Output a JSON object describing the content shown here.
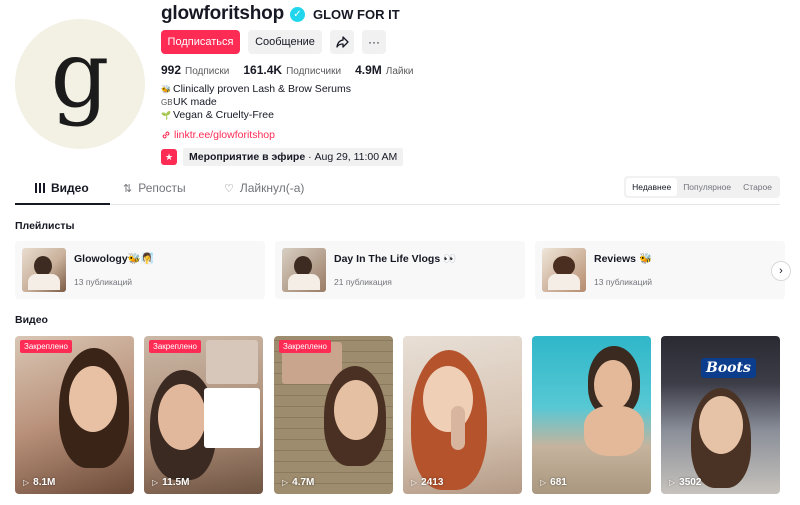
{
  "profile": {
    "avatar_letter": "g",
    "username": "glowforitshop",
    "verified_glyph": "✓",
    "nickname": "GLOW FOR IT",
    "follow_label": "Подписаться",
    "message_label": "Сообщение",
    "share_icon": "share-icon",
    "more_label": "···",
    "stats": [
      {
        "value": "992",
        "label": "Подписки"
      },
      {
        "value": "161.4K",
        "label": "Подписчики"
      },
      {
        "value": "4.9M",
        "label": "Лайки"
      }
    ],
    "bio": [
      {
        "emoji": "🐝",
        "text": "Clinically proven Lash & Brow Serums"
      },
      {
        "emoji": "GB",
        "text": "UK made"
      },
      {
        "emoji": "🌱",
        "text": "Vegan & Cruelty-Free"
      }
    ],
    "link": "linktr.ee/glowforitshop",
    "event": {
      "title": "Мероприятие в эфире",
      "date": " · Aug 29, 11:00 AM"
    }
  },
  "tabs": [
    {
      "label": "Видео",
      "icon": "grid-icon"
    },
    {
      "label": "Репосты",
      "icon": "repost-icon"
    },
    {
      "label": "Лайкнул(-а)",
      "icon": "heart-icon"
    }
  ],
  "sort": [
    "Недавнее",
    "Популярное",
    "Старое"
  ],
  "playlists": {
    "title": "Плейлисты",
    "items": [
      {
        "name": "Glowology🐝🧖‍♀️",
        "count": "13 публикаций"
      },
      {
        "name": "Day In The Life Vlogs 👀",
        "count": "21 публикация"
      },
      {
        "name": "Reviews 🐝",
        "count": "13 публикаций"
      }
    ],
    "next_label": "›"
  },
  "videos": {
    "title": "Видео",
    "items": [
      {
        "views": "8.1M",
        "pinned": "Закреплено"
      },
      {
        "views": "11.5M",
        "pinned": "Закреплено"
      },
      {
        "views": "4.7M",
        "pinned": "Закреплено"
      },
      {
        "views": "2413",
        "pinned": ""
      },
      {
        "views": "681",
        "pinned": ""
      },
      {
        "views": "3502",
        "pinned": "",
        "sign": "Boots"
      }
    ]
  },
  "colors": {
    "accent": "#fe2c55",
    "verified": "#20d5ec"
  }
}
